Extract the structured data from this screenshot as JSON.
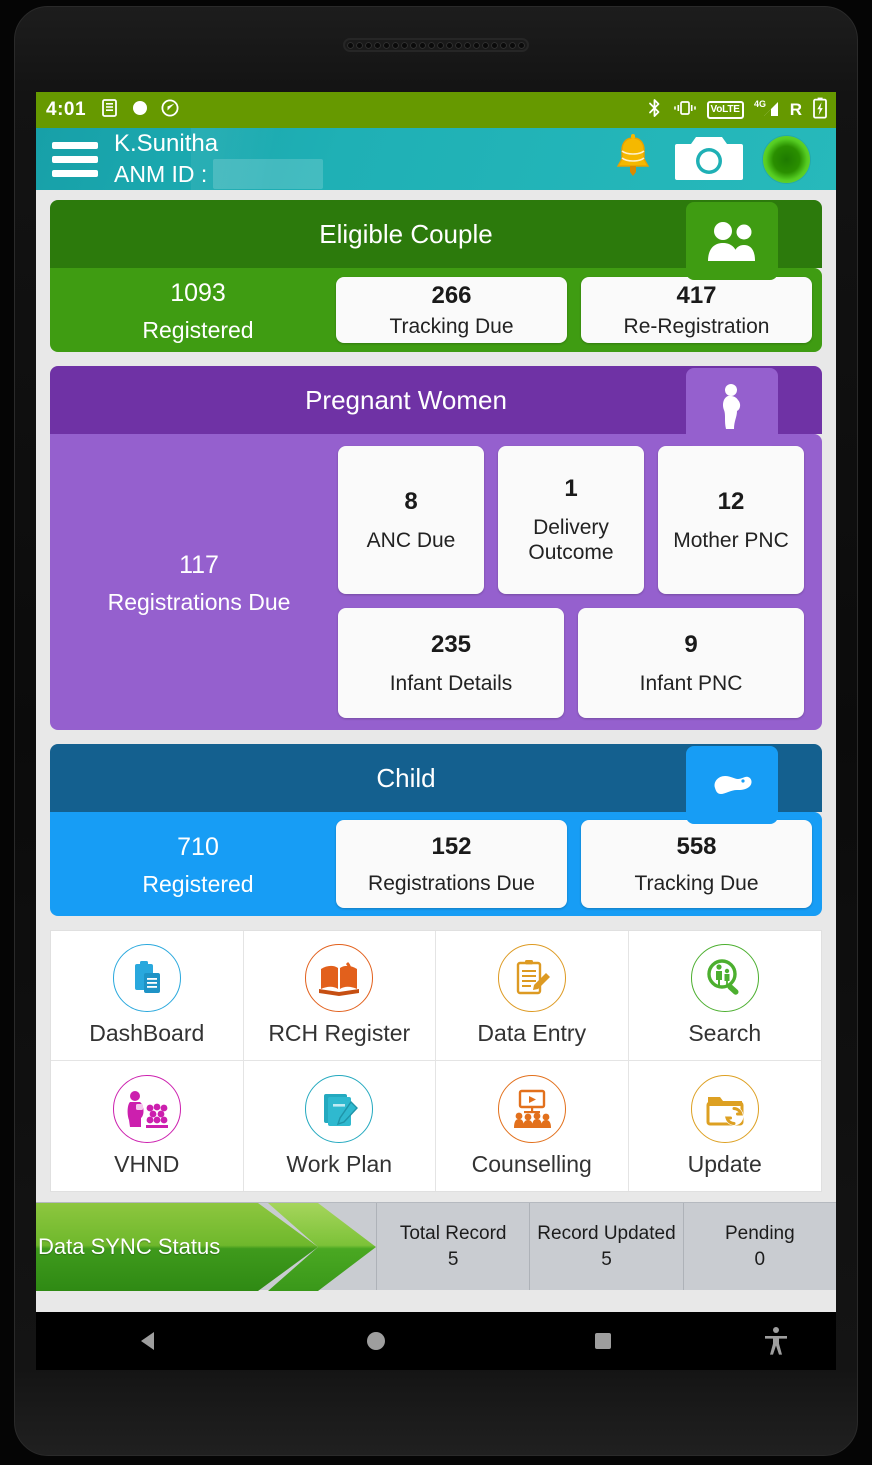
{
  "status_bar": {
    "time": "4:01",
    "left_icons": [
      "sim-card-icon",
      "record-dot-icon",
      "data-saver-icon"
    ],
    "right_icons": [
      "bluetooth-icon",
      "vibrate-icon",
      "volte-icon",
      "signal-4g-icon",
      "roaming-icon",
      "battery-charging-icon"
    ],
    "volte_label": "VoLTE",
    "network_label": "4G",
    "roaming_label": "R",
    "background_color": "#669900"
  },
  "app_bar": {
    "menu_icon": "hamburger-menu-icon",
    "user_name": "K.Sunitha",
    "anm_id_label": "ANM ID :",
    "anm_id_value": "",
    "bell_icon": "notification-bell-icon",
    "camera_icon": "camera-icon",
    "status_indicator": "sync-status-indicator",
    "background_color": "#20b2b6"
  },
  "cards": {
    "eligible_couple": {
      "title": "Eligible Couple",
      "icon": "couple-icon",
      "header_color": "#2c7a0c",
      "body_color": "#3f9c12",
      "primary": {
        "value": "1093",
        "label": "Registered"
      },
      "tiles": [
        {
          "value": "266",
          "label": "Tracking Due"
        },
        {
          "value": "417",
          "label": "Re-Registration"
        }
      ]
    },
    "pregnant_women": {
      "title": "Pregnant Women",
      "icon": "pregnant-woman-icon",
      "header_color": "#6f32a5",
      "body_color": "#9560ce",
      "primary": {
        "value": "117",
        "label": "Registrations Due"
      },
      "tiles_row1": [
        {
          "value": "8",
          "label": "ANC Due"
        },
        {
          "value": "1",
          "label": "Delivery Outcome"
        },
        {
          "value": "12",
          "label": "Mother PNC"
        }
      ],
      "tiles_row2": [
        {
          "value": "235",
          "label": "Infant Details"
        },
        {
          "value": "9",
          "label": "Infant PNC"
        }
      ]
    },
    "child": {
      "title": "Child",
      "icon": "baby-icon",
      "header_color": "#14608f",
      "body_color": "#179df5",
      "primary": {
        "value": "710",
        "label": "Registered"
      },
      "tiles": [
        {
          "value": "152",
          "label": "Registrations Due"
        },
        {
          "value": "558",
          "label": "Tracking Due"
        }
      ]
    }
  },
  "menu_grid": [
    {
      "label": "DashBoard",
      "icon": "clipboard-icon",
      "color": "#29a8dd"
    },
    {
      "label": "RCH Register",
      "icon": "open-book-icon",
      "color": "#e2601c"
    },
    {
      "label": "Data Entry",
      "icon": "form-pencil-icon",
      "color": "#dd9a22"
    },
    {
      "label": "Search",
      "icon": "family-search-icon",
      "color": "#4caf2f"
    },
    {
      "label": "VHND",
      "icon": "mother-group-icon",
      "color": "#cc1fae"
    },
    {
      "label": "Work Plan",
      "icon": "notebook-pencil-icon",
      "color": "#24a9bf"
    },
    {
      "label": "Counselling",
      "icon": "presentation-group-icon",
      "color": "#e2701c"
    },
    {
      "label": "Update",
      "icon": "folder-sync-icon",
      "color": "#ddа022"
    }
  ],
  "sync_bar": {
    "title": "Data SYNC Status",
    "cells": [
      {
        "label": "Total Record",
        "value": "5"
      },
      {
        "label": "Record Updated",
        "value": "5"
      },
      {
        "label": "Pending",
        "value": "0"
      }
    ]
  },
  "nav_bar": {
    "buttons": [
      "back-button",
      "home-button",
      "recents-button",
      "accessibility-button"
    ]
  }
}
